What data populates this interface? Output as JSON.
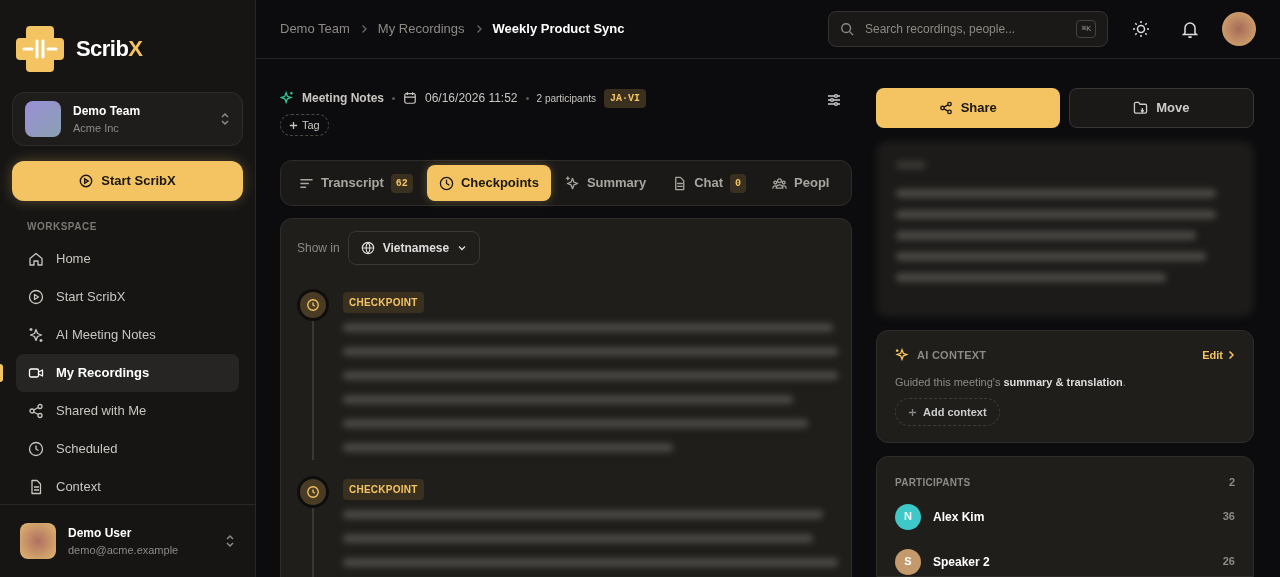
{
  "brand": {
    "name": "Scrib",
    "accent": "X"
  },
  "team": {
    "name": "Demo Team",
    "org": "Acme Inc"
  },
  "start_button": "Start ScribX",
  "nav_section": "WORKSPACE",
  "nav": [
    {
      "label": "Home",
      "selected": false
    },
    {
      "label": "Start ScribX",
      "selected": false
    },
    {
      "label": "AI Meeting Notes",
      "selected": false
    },
    {
      "label": "My Recordings",
      "selected": true
    },
    {
      "label": "Shared with Me",
      "selected": false
    },
    {
      "label": "Scheduled",
      "selected": false
    },
    {
      "label": "Context",
      "selected": false
    }
  ],
  "user": {
    "name": "Demo User",
    "email": "demo@acme.example"
  },
  "breadcrumb": [
    "Demo Team",
    "My Recordings",
    "Weekly Product Sync"
  ],
  "search": {
    "placeholder": "Search recordings, people...",
    "shortcut": "⌘K"
  },
  "meta": {
    "type": "Meeting Notes",
    "datetime": "06/16/2026 11:52",
    "participants": "2 participants",
    "languages": "JA·VI",
    "tag_button": "Tag"
  },
  "tabs": [
    {
      "label": "Transcript",
      "count": "62",
      "selected": false
    },
    {
      "label": "Checkpoints",
      "selected": true
    },
    {
      "label": "Summary",
      "selected": false
    },
    {
      "label": "Chat",
      "count": "0",
      "selected": false
    },
    {
      "label": "Peopl",
      "selected": false
    }
  ],
  "show_in": {
    "label": "Show in",
    "language": "Vietnamese"
  },
  "checkpoints": [
    {
      "label": "CHECKPOINT"
    },
    {
      "label": "CHECKPOINT"
    }
  ],
  "actions": [
    "Share",
    "Move"
  ],
  "ai_context": {
    "title": "AI CONTEXT",
    "edit": "Edit",
    "text": "Guided this meeting's **summary & translation**.",
    "add_button": "Add context"
  },
  "participants": {
    "title": "PARTICIPANTS",
    "count": "2",
    "items": [
      {
        "initial": "N",
        "name": "Alex Kim",
        "count": "36",
        "color": "#3ec8c8"
      },
      {
        "initial": "S",
        "name": "Speaker 2",
        "count": "26",
        "color": "#c49a6c"
      }
    ]
  }
}
